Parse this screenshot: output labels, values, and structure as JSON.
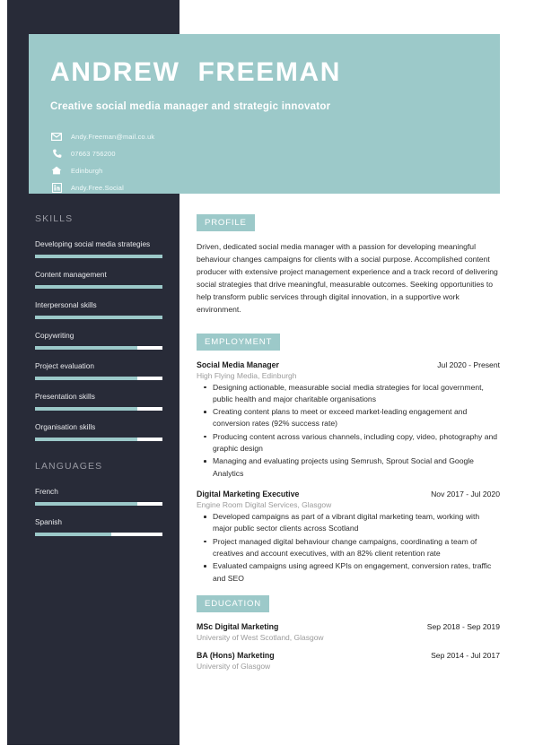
{
  "theme": {
    "accent": "#9cc9c9",
    "sidebar_bg": "#282b38",
    "page_bg": "#ffffff",
    "text": "#2b2b2b",
    "muted": "#9b9b9b"
  },
  "header": {
    "name": "ANDREW  FREEMAN",
    "tagline": "Creative social media manager and strategic innovator",
    "contacts": [
      {
        "icon": "envelope-icon",
        "text": "Andy.Freeman@mail.co.uk"
      },
      {
        "icon": "phone-icon",
        "text": "07663 756200"
      },
      {
        "icon": "home-icon",
        "text": "Edinburgh"
      },
      {
        "icon": "linkedin-icon",
        "text": "Andy.Free.Social"
      }
    ]
  },
  "sidebar": {
    "skills_heading": "SKILLS",
    "skills": [
      {
        "label": "Developing social media strategies",
        "level": 100
      },
      {
        "label": "Content management",
        "level": 100
      },
      {
        "label": "Interpersonal skills",
        "level": 100
      },
      {
        "label": "Copywriting",
        "level": 80
      },
      {
        "label": "Project evaluation",
        "level": 80
      },
      {
        "label": "Presentation skills",
        "level": 80
      },
      {
        "label": "Organisation skills",
        "level": 80
      }
    ],
    "languages_heading": "LANGUAGES",
    "languages": [
      {
        "label": "French",
        "level": 80
      },
      {
        "label": "Spanish",
        "level": 60
      }
    ]
  },
  "main": {
    "profile": {
      "heading": "PROFILE",
      "text": "Driven, dedicated social media manager with a passion for developing meaningful behaviour changes campaigns for clients with a social purpose. Accomplished content producer with extensive project management experience and a track record of delivering social strategies that drive meaningful, measurable outcomes. Seeking opportunities to help transform public services through digital innovation, in a supportive work environment."
    },
    "employment": {
      "heading": "EMPLOYMENT",
      "entries": [
        {
          "title": "Social Media Manager",
          "date": "Jul 2020 - Present",
          "org": "High Flying Media, Edinburgh",
          "bullets": [
            "Designing actionable, measurable social media strategies for local government, public health and major charitable organisations",
            "Creating content plans to meet or exceed market-leading engagement and conversion rates (92% success rate)",
            "Producing content across various channels, including copy, video, photography and graphic design",
            "Managing and evaluating projects using Semrush, Sprout Social and Google Analytics"
          ]
        },
        {
          "title": "Digital Marketing Executive",
          "date": "Nov 2017 - Jul 2020",
          "org": "Engine Room Digital Services, Glasgow",
          "bullets": [
            "Developed campaigns as part of a vibrant digital marketing team, working with major public sector clients across Scotland",
            "Project managed digital behaviour change campaigns, coordinating a team of creatives and account executives, with an 82% client retention rate",
            "Evaluated campaigns using agreed KPIs on engagement, conversion rates, traffic and SEO"
          ]
        }
      ]
    },
    "education": {
      "heading": "EDUCATION",
      "entries": [
        {
          "title": "MSc Digital Marketing",
          "date": "Sep 2018 - Sep 2019",
          "org": "University of West Scotland, Glasgow"
        },
        {
          "title": "BA (Hons) Marketing",
          "date": "Sep 2014 - Jul 2017",
          "org": "University of Glasgow"
        }
      ]
    }
  }
}
